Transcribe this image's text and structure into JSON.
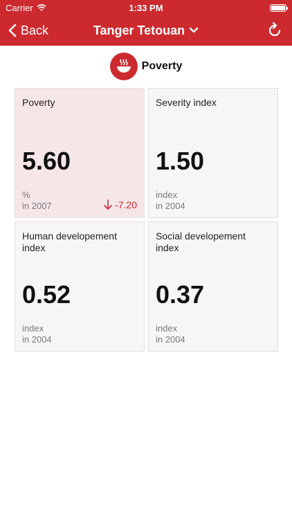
{
  "status_bar": {
    "carrier": "Carrier",
    "time": "1:33 PM"
  },
  "nav": {
    "back_label": "Back",
    "title": "Tanger Tetouan"
  },
  "section": {
    "title": "Poverty"
  },
  "cards": [
    {
      "title": "Poverty",
      "value": "5.60",
      "unit": "%",
      "year": "in 2007",
      "change": "-7.20"
    },
    {
      "title": "Severity index",
      "value": "1.50",
      "unit": "index",
      "year": "in 2004"
    },
    {
      "title": "Human developement index",
      "value": "0.52",
      "unit": "index",
      "year": "in 2004"
    },
    {
      "title": "Social developement index",
      "value": "0.37",
      "unit": "index",
      "year": "in 2004"
    }
  ],
  "colors": {
    "accent": "#cc2a2f",
    "card_bg": "#f6f6f6",
    "card_highlight": "#f6e6e7"
  },
  "icons": [
    "wifi-icon",
    "battery-icon",
    "chevron-left-icon",
    "chevron-down-icon",
    "refresh-icon",
    "soup-bowl-icon",
    "down-arrow-icon"
  ]
}
